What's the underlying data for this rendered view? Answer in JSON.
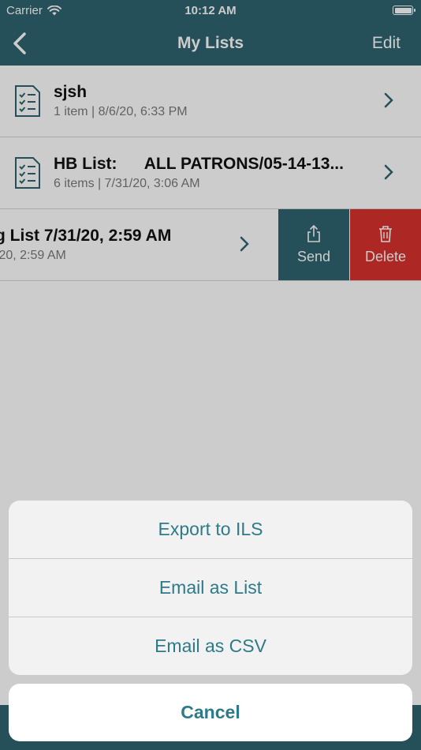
{
  "status_bar": {
    "carrier": "Carrier",
    "time": "10:12 AM"
  },
  "nav": {
    "title": "My Lists",
    "edit_label": "Edit"
  },
  "lists": [
    {
      "name": "sjsh",
      "meta": "1 item  |  8/6/20, 6:33 PM"
    },
    {
      "name": "HB List:      ALL PATRONS/05-14-13...",
      "meta": "6 items  |  7/31/20, 3:06 AM"
    },
    {
      "name": "g List 7/31/20, 2:59 AM",
      "meta": "/20, 2:59 AM"
    }
  ],
  "swipe_actions": {
    "send_label": "Send",
    "delete_label": "Delete"
  },
  "action_sheet": {
    "options": [
      "Export to ILS",
      "Email as List",
      "Email as CSV"
    ],
    "cancel_label": "Cancel"
  },
  "colors": {
    "primary": "#2f6370",
    "accent_text": "#2e7a88",
    "delete": "#d9322e"
  }
}
